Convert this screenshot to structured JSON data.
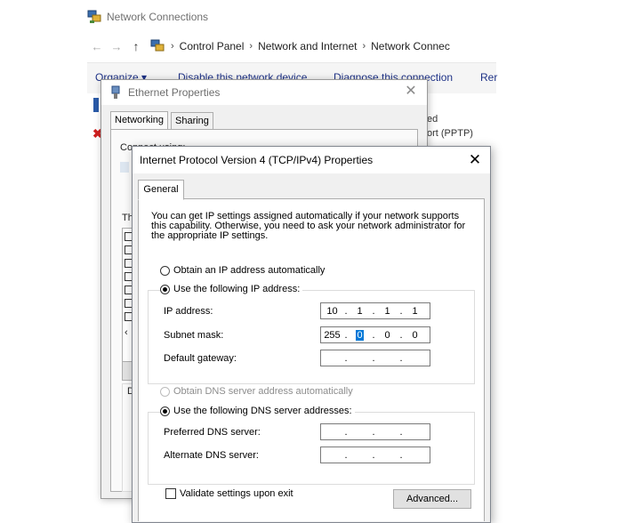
{
  "explorer": {
    "title": "Network Connections",
    "breadcrumbs": [
      "Control Panel",
      "Network and Internet",
      "Network Connec"
    ],
    "commands": [
      "Organize ▾",
      "Disable this network device",
      "Diagnose this connection",
      "Rer"
    ],
    "side_fragments": [
      "ed",
      "ort (PPTP)"
    ]
  },
  "ethernet_dialog": {
    "title": "Ethernet Properties",
    "tabs": [
      "Networking",
      "Sharing"
    ],
    "connect_fragment": "Connect using:",
    "this_fragment": "Th",
    "d_fragment": "D"
  },
  "ipv4_dialog": {
    "title": "Internet Protocol Version 4 (TCP/IPv4) Properties",
    "tab": "General",
    "description": "You can get IP settings assigned automatically if your network supports this capability. Otherwise, you need to ask your network administrator for the appropriate IP settings.",
    "ip_mode": {
      "auto_label": "Obtain an IP address automatically",
      "manual_label": "Use the following IP address:",
      "selected": "manual"
    },
    "ip_fields": {
      "ip_address_label": "IP address:",
      "ip_address": [
        "10",
        "1",
        "1",
        "1"
      ],
      "subnet_mask_label": "Subnet mask:",
      "subnet_mask": [
        "255",
        "0",
        "0",
        "0"
      ],
      "gateway_label": "Default gateway:",
      "gateway": [
        "",
        "",
        "",
        ""
      ]
    },
    "dns_mode": {
      "auto_label": "Obtain DNS server address automatically",
      "manual_label": "Use the following DNS server addresses:",
      "selected": "manual"
    },
    "dns_fields": {
      "preferred_label": "Preferred DNS server:",
      "preferred": [
        "",
        "",
        "",
        ""
      ],
      "alternate_label": "Alternate DNS server:",
      "alternate": [
        "",
        "",
        "",
        ""
      ]
    },
    "validate_label": "Validate settings upon exit",
    "validate_checked": false,
    "advanced_button": "Advanced..."
  },
  "colors": {
    "accent": "#0078d7",
    "link": "#1e3287",
    "dialog_bg": "#f0f0f0"
  }
}
